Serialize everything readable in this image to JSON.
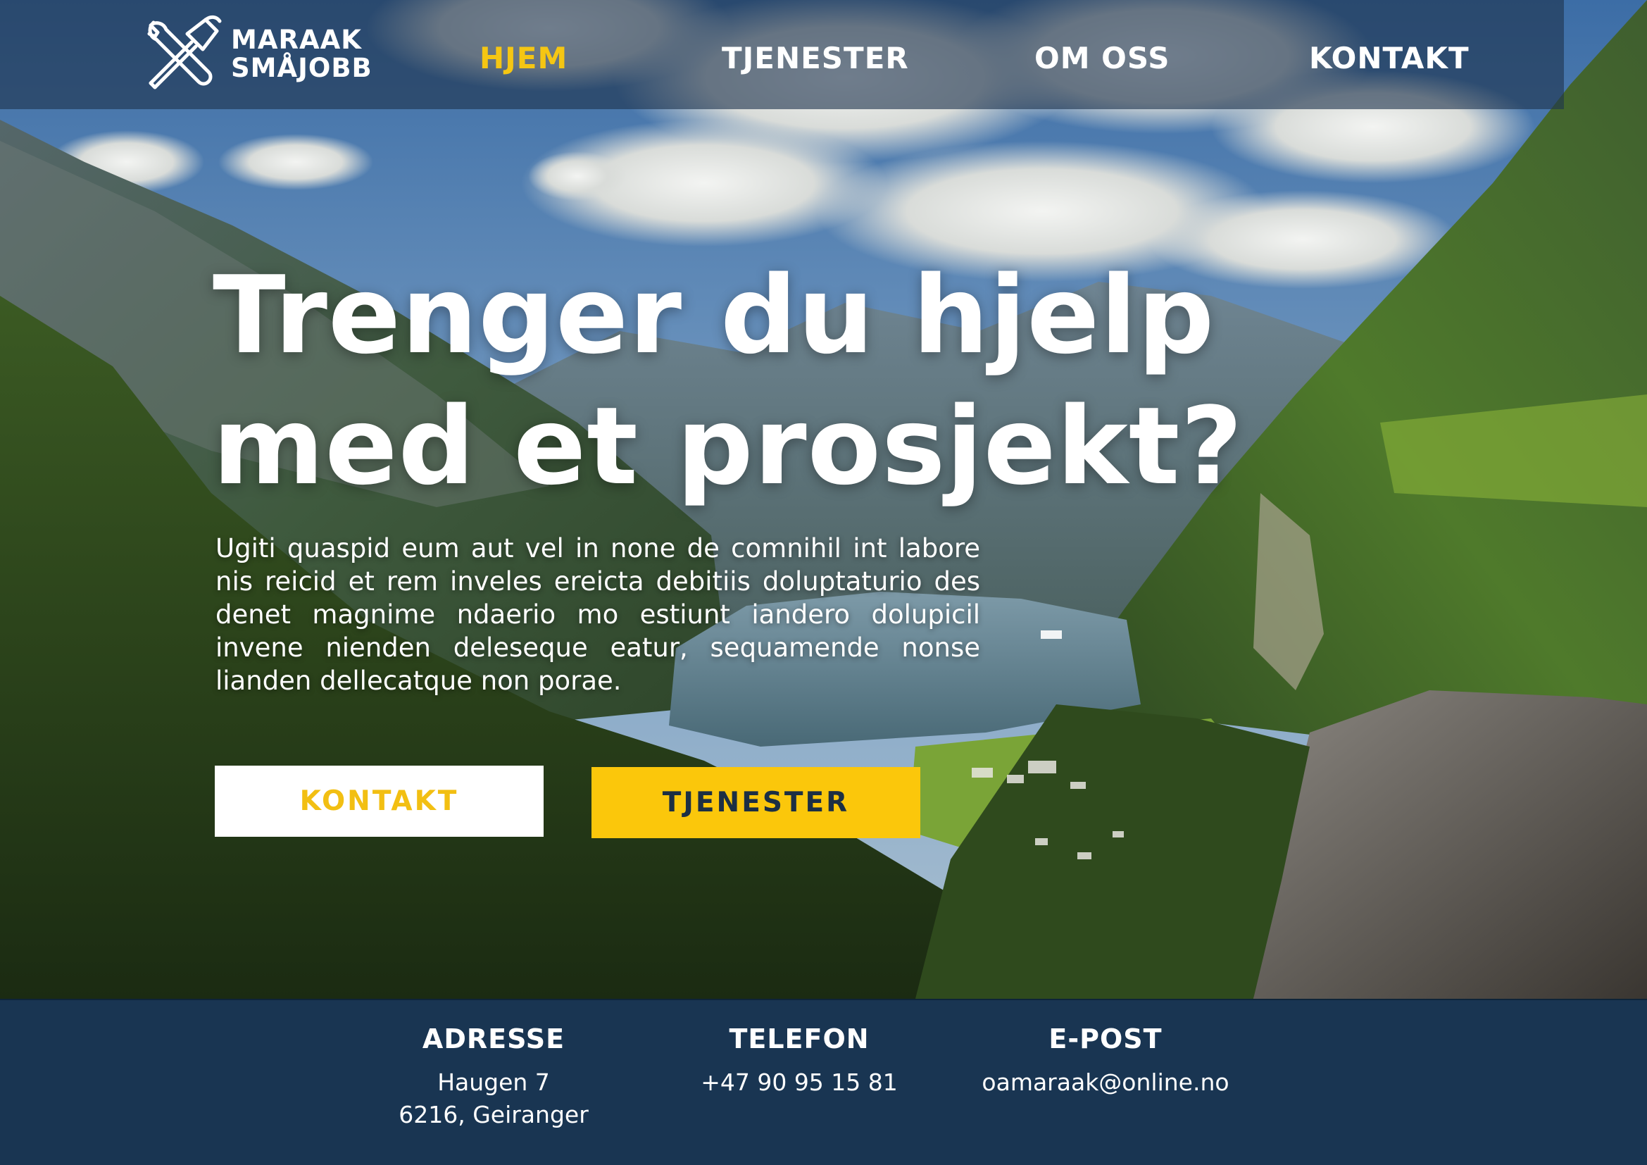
{
  "brand": {
    "line1": "MARAAK",
    "line2": "SMÅJOBB",
    "logo_icon": "hammer-and-wrench-icon"
  },
  "nav": {
    "items": [
      {
        "label": "HJEM",
        "active": true
      },
      {
        "label": "TJENESTER",
        "active": false
      },
      {
        "label": "OM OSS",
        "active": false
      },
      {
        "label": "KONTAKT",
        "active": false
      }
    ]
  },
  "hero": {
    "headline_line1": "Trenger du hjelp",
    "headline_line2": "med et prosjekt?",
    "lead": "Ugiti quaspid eum aut vel in none de comnihil int labore nis reicid et rem inveles ereicta debitiis doluptaturio des denet magnime ndaerio mo estiunt iandero dolupicil invene nienden deleseque eatur, sequamende nonse lianden dellecatque non porae."
  },
  "cta": {
    "contact_label": "KONTAKT",
    "services_label": "TJENESTER"
  },
  "footer": {
    "address": {
      "heading": "ADRESSE",
      "line1": "Haugen 7",
      "line2": "6216, Geiranger"
    },
    "phone": {
      "heading": "TELEFON",
      "value": "+47 90 95 15 81"
    },
    "email": {
      "heading": "E-POST",
      "value": "oamaraak@online.no"
    }
  },
  "colors": {
    "accent_yellow": "#fbc70b",
    "nav_active": "#f5c613",
    "footer_bg": "#193552",
    "navbar_bg": "rgba(30, 52, 78, 0.62)",
    "button_text_dark": "#1c2f44"
  }
}
